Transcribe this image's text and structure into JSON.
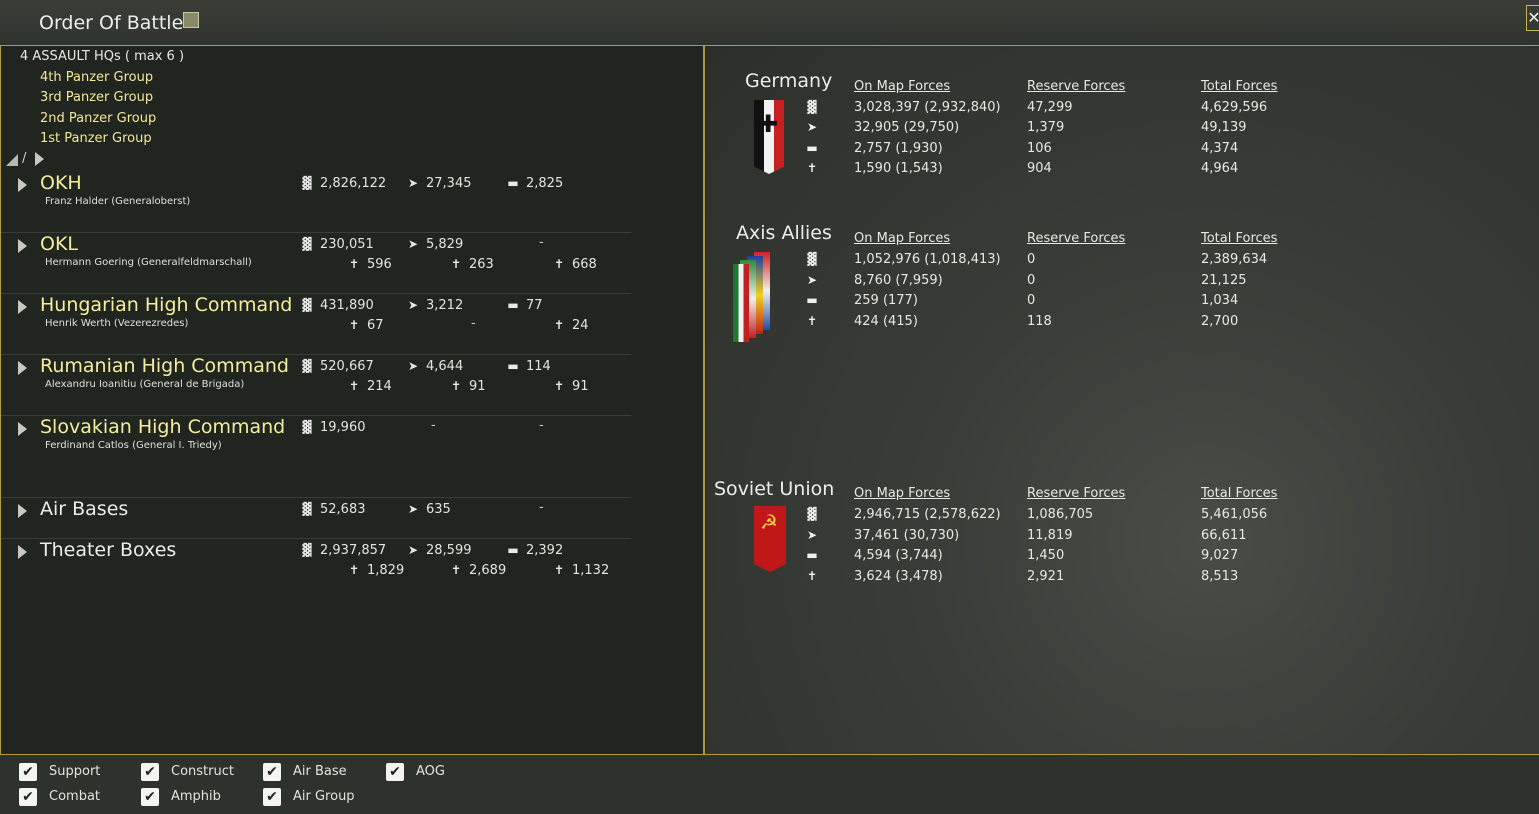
{
  "window": {
    "title": "Order Of Battle",
    "close_label": "✕"
  },
  "icons": {
    "men": "▓",
    "gun": "➤",
    "tank": "▬",
    "plane": "✝"
  },
  "hq": {
    "header": "4 ASSAULT HQs ( max 6 )",
    "items": [
      "4th Panzer Group",
      "3rd Panzer Group",
      "2nd Panzer Group",
      "1st Panzer Group"
    ],
    "nav_slash": "/"
  },
  "commands": [
    {
      "name": "OKH",
      "leader": "Franz Halder  (Generaloberst)",
      "men": "2,826,122",
      "guns": "27,345",
      "afv": "2,825",
      "aircraft": [
        "",
        "",
        ""
      ],
      "dashes": []
    },
    {
      "name": "OKL",
      "leader": "Hermann Goering  (Generalfeldmarschall)",
      "men": "230,051",
      "guns": "5,829",
      "afv": "-",
      "aircraft": [
        "596",
        "263",
        "668"
      ]
    },
    {
      "name": "Hungarian High Command",
      "leader": "Henrik Werth  (Vezerezredes)",
      "men": "431,890",
      "guns": "3,212",
      "afv": "77",
      "aircraft": [
        "67",
        "-",
        "24"
      ]
    },
    {
      "name": "Rumanian High Command",
      "leader": "Alexandru Ioanitiu  (General de Brigada)",
      "men": "520,667",
      "guns": "4,644",
      "afv": "114",
      "aircraft": [
        "214",
        "91",
        "91"
      ]
    },
    {
      "name": "Slovakian High Command",
      "leader": "Ferdinand Catlos  (General I. Triedy)",
      "men": "19,960",
      "guns": "-",
      "afv": "-"
    },
    {
      "name": "Air Bases",
      "men": "52,683",
      "guns": "635",
      "afv": "-"
    },
    {
      "name": "Theater Boxes",
      "men": "2,937,857",
      "guns": "28,599",
      "afv": "2,392",
      "aircraft": [
        "1,829",
        "2,689",
        "1,132"
      ]
    }
  ],
  "nations": {
    "headers": {
      "onmap": "On Map Forces",
      "reserve": "Reserve Forces",
      "total": "Total Forces"
    },
    "germany": {
      "name": "Germany",
      "rows": [
        [
          "3,028,397 (2,932,840)",
          "47,299",
          "4,629,596"
        ],
        [
          "32,905 (29,750)",
          "1,379",
          "49,139"
        ],
        [
          "2,757 (1,930)",
          "106",
          "4,374"
        ],
        [
          "1,590 (1,543)",
          "904",
          "4,964"
        ]
      ]
    },
    "axis": {
      "name": "Axis Allies",
      "rows": [
        [
          "1,052,976 (1,018,413)",
          "0",
          "2,389,634"
        ],
        [
          "8,760 (7,959)",
          "0",
          "21,125"
        ],
        [
          "259 (177)",
          "0",
          "1,034"
        ],
        [
          "424 (415)",
          "118",
          "2,700"
        ]
      ]
    },
    "soviet": {
      "name": "Soviet Union",
      "rows": [
        [
          "2,946,715 (2,578,622)",
          "1,086,705",
          "5,461,056"
        ],
        [
          "37,461 (30,730)",
          "11,819",
          "66,611"
        ],
        [
          "4,594 (3,744)",
          "1,450",
          "9,027"
        ],
        [
          "3,624 (3,478)",
          "2,921",
          "8,513"
        ]
      ]
    }
  },
  "filters": [
    "Support",
    "Construct",
    "Air Base",
    "AOG",
    "Combat",
    "Amphib",
    "Air Group"
  ],
  "check_mark": "✔",
  "flag_symbols": {
    "germany": "✚",
    "soviet": "☭"
  },
  "colors": {
    "accent_gold": "#b09a3e",
    "command_yellow": "#f4ee9c",
    "hq_yellow": "#f2e79a",
    "soviet_red": "#c01818"
  }
}
